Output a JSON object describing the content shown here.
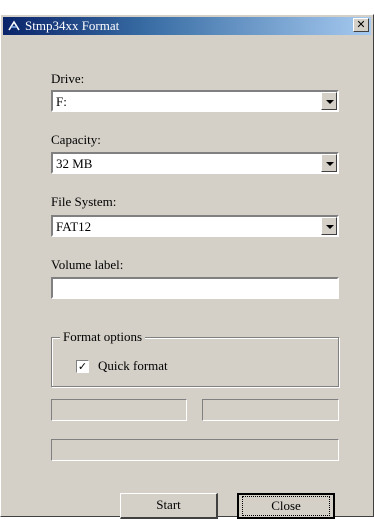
{
  "window": {
    "title": "Stmp34xx Format"
  },
  "drive": {
    "label": "Drive:",
    "value": "F:"
  },
  "capacity": {
    "label": "Capacity:",
    "value": "32 MB"
  },
  "filesystem": {
    "label": "File System:",
    "value": "FAT12"
  },
  "volume": {
    "label": "Volume label:",
    "value": ""
  },
  "options": {
    "legend": "Format options",
    "quick_format_label": "Quick format",
    "quick_format_checked": true
  },
  "buttons": {
    "start": "Start",
    "close": "Close"
  },
  "colors": {
    "titlebar_start": "#0a246a",
    "titlebar_end": "#a6caf0",
    "face": "#d4d0c8"
  },
  "icons": {
    "app": "stmp-app-icon",
    "close": "close-icon",
    "dropdown": "chevron-down-icon",
    "check": "checkmark-icon"
  }
}
